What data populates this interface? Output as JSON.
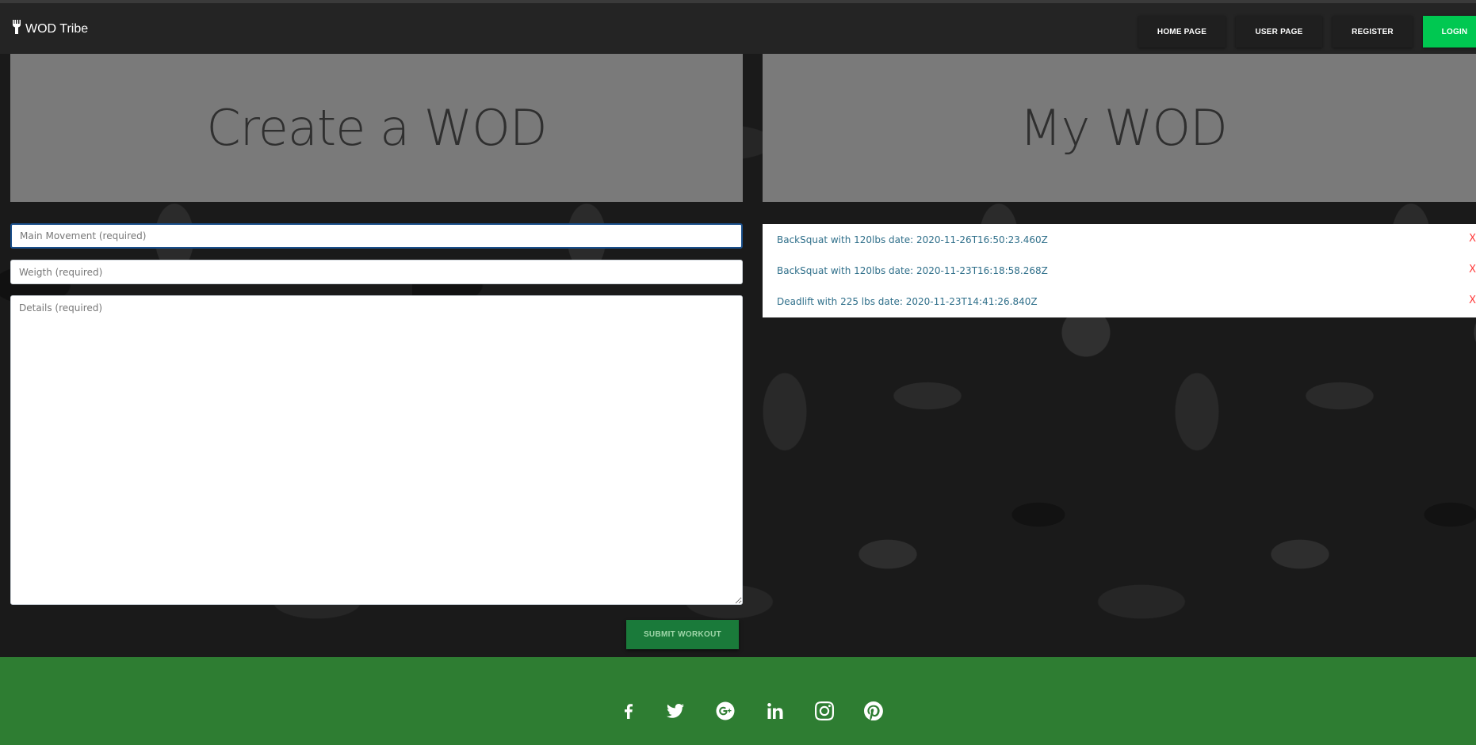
{
  "brand": {
    "name": "WOD Tribe",
    "icon": "fork-icon"
  },
  "nav": {
    "home": "HOME PAGE",
    "user": "USER PAGE",
    "register": "REGISTER",
    "login": "LOGIN"
  },
  "create_panel": {
    "title": "Create a WOD"
  },
  "my_panel": {
    "title": "My WOD"
  },
  "form": {
    "main_placeholder": "Main Movement (required)",
    "weight_placeholder": "Weigth (required)",
    "details_placeholder": "Details (required)",
    "submit_label": "SUBMIT WORKOUT"
  },
  "wods": [
    {
      "text": "BackSquat with 120lbs date: 2020-11-26T16:50:23.460Z",
      "remove": "X"
    },
    {
      "text": "BackSquat with 120lbs date: 2020-11-23T16:18:58.268Z",
      "remove": "X"
    },
    {
      "text": "Deadlift with 225 lbs date: 2020-11-23T14:41:26.840Z",
      "remove": "X"
    }
  ],
  "footer": {
    "social_icons": [
      "facebook-icon",
      "twitter-icon",
      "google-plus-icon",
      "linkedin-icon",
      "instagram-icon",
      "pinterest-icon"
    ]
  },
  "colors": {
    "navbar": "#242424",
    "login_accent": "#00c851",
    "footer": "#2e7d32",
    "submit": "#1a7a3a",
    "remove": "#ff3b3b",
    "panel": "#7a7a7a"
  }
}
